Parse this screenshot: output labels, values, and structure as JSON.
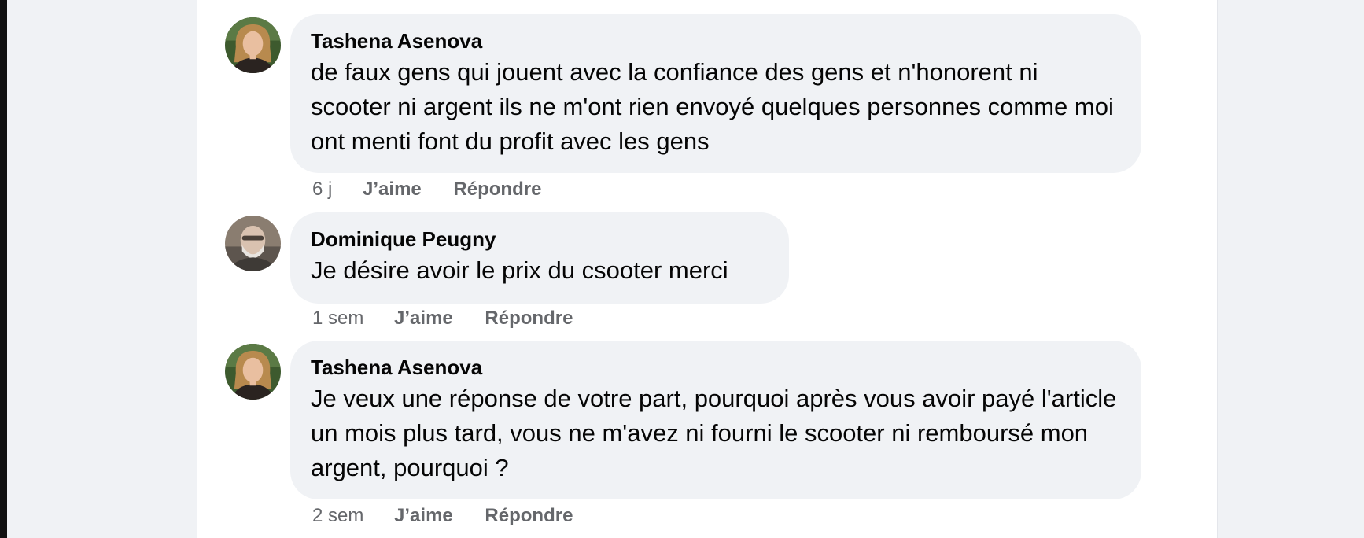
{
  "comments": [
    {
      "author": "Tashena Asenova",
      "text": "de faux gens qui jouent avec la confiance des gens et n'honorent ni scooter ni argent ils ne m'ont rien envoyé quelques personnes comme moi ont menti font du profit avec les gens",
      "time": "6 j",
      "like_label": "J’aime",
      "reply_label": "Répondre"
    },
    {
      "author": "Dominique Peugny",
      "text": "Je désire avoir le prix du csooter merci",
      "time": "1 sem",
      "like_label": "J’aime",
      "reply_label": "Répondre"
    },
    {
      "author": "Tashena Asenova",
      "text": "Je veux une réponse de votre part, pourquoi après vous avoir payé l'article un mois plus tard, vous ne m'avez ni fourni le scooter ni remboursé mon argent, pourquoi ?",
      "time": "2 sem",
      "like_label": "J’aime",
      "reply_label": "Répondre"
    }
  ],
  "colors": {
    "page_background": "#f0f2f5",
    "bubble_background": "#f0f2f5",
    "text_primary": "#050505",
    "text_secondary": "#65676b"
  }
}
